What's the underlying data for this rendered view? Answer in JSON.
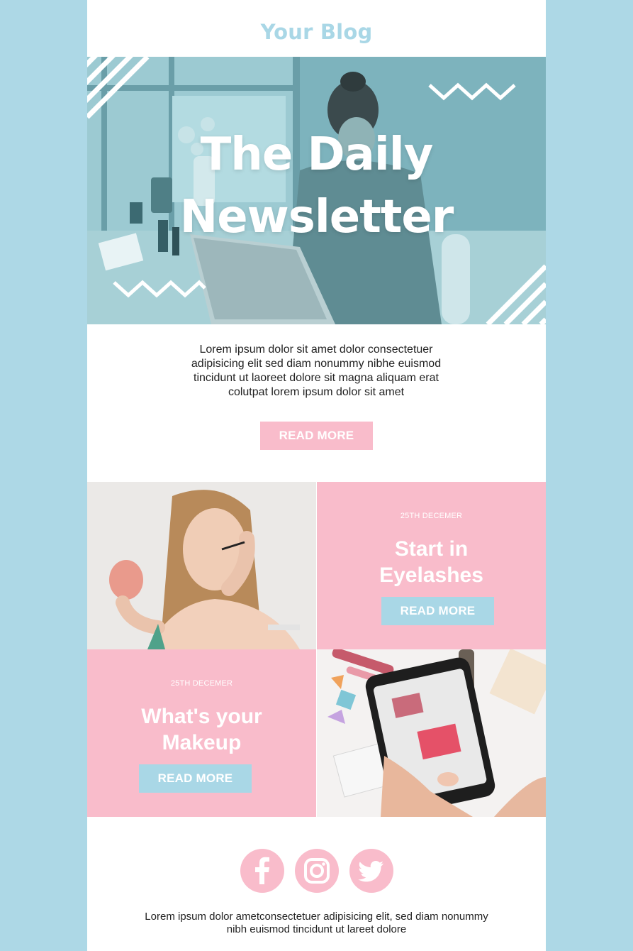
{
  "theme": {
    "background": "#add8e6",
    "blue": "#a9d7e6",
    "pink": "#f9bccb",
    "hero_tint": "#7fb5bf"
  },
  "header": {
    "brand": "Your Blog"
  },
  "hero": {
    "title_line1": "The Daily",
    "title_line2": "Newsletter"
  },
  "intro": {
    "text": "Lorem ipsum dolor sit amet dolor consectetuer adipisicing elit sed diam nonummy nibhe euismod tincidunt ut laoreet dolore sit magna aliquam erat colutpat lorem ipsum dolor sit amet",
    "button_label": "READ MORE"
  },
  "articles": [
    {
      "date": "25TH DECEMER",
      "title_line1": "Start in",
      "title_line2": "Eyelashes",
      "button_label": "READ MORE"
    },
    {
      "date": "25TH DECEMER",
      "title_line1": "What's your",
      "title_line2": "Makeup",
      "button_label": "READ MORE"
    }
  ],
  "social": {
    "icons": [
      "facebook-icon",
      "instagram-icon",
      "twitter-icon"
    ]
  },
  "footer": {
    "text": "Lorem ipsum dolor ametconsectetuer adipisicing elit, sed diam nonummy nibh euismod tincidunt ut lareet dolore"
  }
}
